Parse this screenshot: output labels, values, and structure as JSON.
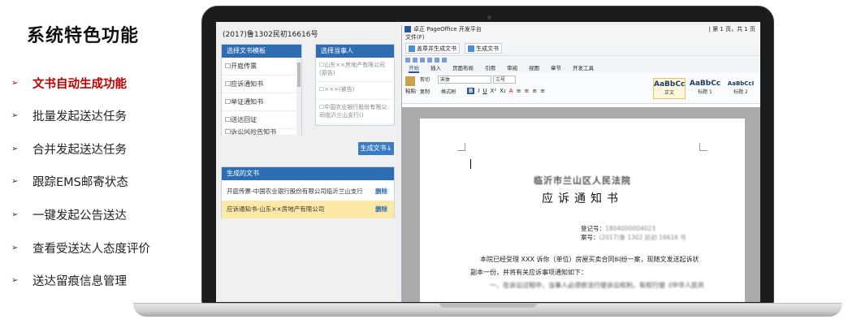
{
  "features": {
    "title": "系统特色功能",
    "items": [
      {
        "label": "文书自动生成功能",
        "active": true
      },
      {
        "label": "批量发起送达任务",
        "active": false
      },
      {
        "label": "合并发起送达任务",
        "active": false
      },
      {
        "label": "跟踪EMS邮寄状态",
        "active": false
      },
      {
        "label": "一键发起公告送达",
        "active": false
      },
      {
        "label": "查看受送达人态度评价",
        "active": false
      },
      {
        "label": "送达留痕信息管理",
        "active": false
      }
    ],
    "bullet": "➢"
  },
  "web": {
    "case_number": "(2017)鲁1302民初16616号",
    "doc_type_panel": {
      "header": "选择文书模板",
      "items": [
        "☐开庭传票",
        "☐应诉通知书",
        "☐举证通知书",
        "☐送达回证",
        "☐诉讼风险告知书"
      ]
    },
    "party_panel": {
      "header": "选择当事人",
      "items": [
        "☐山东××房地产有限公司(原告)",
        "☐×××(被告)",
        "☐中国农业银行股份有限公司临沂兰山支行()"
      ]
    },
    "generate_button": "生成文书↓",
    "generated_panel": {
      "header": "生成的文书",
      "rows": [
        {
          "name": "开庭传票-中国农业银行股份有限公司临沂兰山支行",
          "action": "删除"
        },
        {
          "name": "应诉通知书-山东××房地产有限公司",
          "action": "删除"
        }
      ]
    }
  },
  "office": {
    "title": "卓正 PageOffice 开发平台",
    "page_info": "| 第 1 页，共 1 页",
    "menu_file": "文件(F)",
    "toolbar": {
      "seal_button": "盖章并生成文书",
      "generate_button": "生成文书"
    },
    "ribbon_tabs": [
      "开始",
      "插入",
      "页面布局",
      "引用",
      "审阅",
      "视图",
      "章节",
      "开发工具"
    ],
    "ribbon": {
      "paste_label": "粘贴·",
      "cut_label": "剪切",
      "copy_label": "复制",
      "format_label": "格式刷",
      "font_value": "宋体",
      "size_value": "三号",
      "styles": [
        {
          "sample": "AaBbCc",
          "name": "正文"
        },
        {
          "sample": "AaBbCc",
          "name": "标题 1"
        },
        {
          "sample": "AaBbCcI",
          "name": "标题 2"
        }
      ]
    },
    "document": {
      "court": "临沂市兰山区人民法院",
      "title": "应诉通知书",
      "number_label": "登记号：",
      "number_value": "1804000004023",
      "case_label": "案号：",
      "case_value": "(2017)鲁 1302 民初 16616 号",
      "para1": "本院已经受理 XXX 诉你（单位）房屋买卖合同纠纷一案，现随文发送起诉状",
      "para2": "副本一份，并将有关应诉事项通知如下：",
      "para3": "一、在诉讼过程中，当事人必须依法行使诉讼权利，有权行使《中华人民共"
    }
  }
}
